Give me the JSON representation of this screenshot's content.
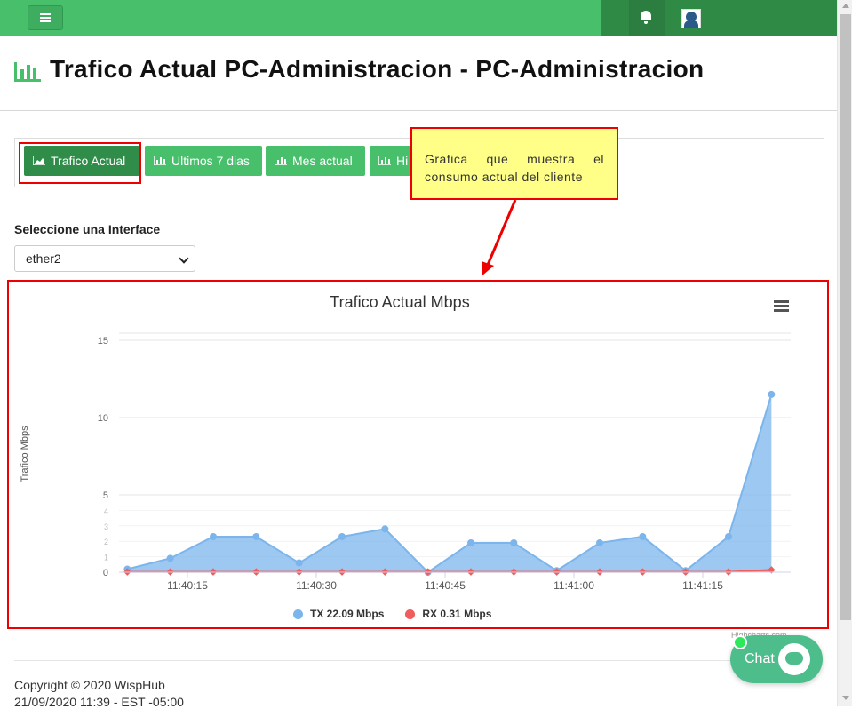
{
  "header": {
    "menu_icon": "hamburger-icon",
    "bell_icon": "bell-icon",
    "avatar_icon": "user-avatar"
  },
  "page": {
    "title": "Trafico Actual PC-Administracion - PC-Administracion",
    "title_icon": "bar-chart-icon"
  },
  "tabs": [
    {
      "label": "Trafico Actual",
      "icon": "area-chart-icon",
      "active": true
    },
    {
      "label": "Ultimos 7 dias",
      "icon": "bar-chart-icon",
      "active": false
    },
    {
      "label": "Mes actual",
      "icon": "bar-chart-icon",
      "active": false
    },
    {
      "label": "Hi",
      "icon": "bar-chart-icon",
      "active": false
    }
  ],
  "callout": {
    "text": "Grafica que muestra el consumo actual del cliente"
  },
  "interface": {
    "label": "Seleccione una Interface",
    "selected": "ether2"
  },
  "chart_data": {
    "type": "area",
    "title": "Trafico Actual Mbps",
    "ylabel": "Trafico Mbps",
    "xlabel": "",
    "x_ticks": [
      "11:40:15",
      "11:40:30",
      "11:40:45",
      "11:41:00",
      "11:41:15"
    ],
    "y_ticks": [
      0,
      5,
      10,
      15
    ],
    "y_minor_ticks": [
      1,
      2,
      3,
      4
    ],
    "ylim": [
      0,
      15
    ],
    "grid": true,
    "x": [
      "11:40:08",
      "11:40:13",
      "11:40:18",
      "11:40:23",
      "11:40:28",
      "11:40:33",
      "11:40:38",
      "11:40:43",
      "11:40:48",
      "11:40:53",
      "11:40:58",
      "11:41:03",
      "11:41:08",
      "11:41:13",
      "11:41:18",
      "11:41:23"
    ],
    "series": [
      {
        "name": "TX 22.09 Mbps",
        "color": "#7cb5ec",
        "values": [
          0.2,
          0.9,
          2.3,
          2.3,
          0.6,
          2.3,
          2.8,
          0.0,
          1.9,
          1.9,
          0.1,
          1.9,
          2.3,
          0.1,
          2.3,
          11.5
        ]
      },
      {
        "name": "RX 0.31 Mbps",
        "color": "#f15c5c",
        "values": [
          0.02,
          0.02,
          0.02,
          0.02,
          0.02,
          0.02,
          0.02,
          0.02,
          0.02,
          0.02,
          0.02,
          0.02,
          0.02,
          0.02,
          0.02,
          0.15
        ]
      }
    ],
    "legend_position": "bottom-center",
    "credits": "Highcharts.com"
  },
  "footer": {
    "copyright": "Copyright © 2020 WispHub",
    "datetime": "21/09/2020 11:39 - EST -05:00"
  },
  "chat": {
    "label": "Chat",
    "icon": "chat-bubble-icon"
  },
  "colors": {
    "brand_green": "#47bf6b",
    "dark_green": "#2f8a46",
    "highlight_red": "#ee0000",
    "callout_yellow": "#ffff88"
  }
}
